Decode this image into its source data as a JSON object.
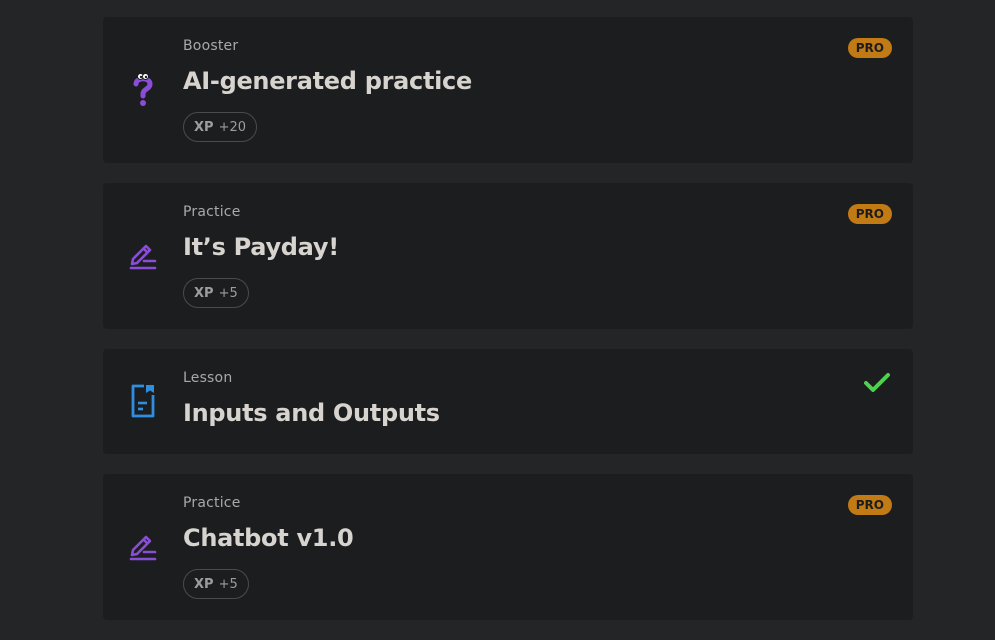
{
  "items": [
    {
      "kind": "Booster",
      "title": "AI-generated practice",
      "xp_label": "XP",
      "xp_value": "+20",
      "badge": "PRO",
      "icon": "question-mark-icon",
      "icon_color": "#8a4dd8"
    },
    {
      "kind": "Practice",
      "title": "It’s Payday!",
      "xp_label": "XP",
      "xp_value": "+5",
      "badge": "PRO",
      "icon": "pencil-edit-icon",
      "icon_color": "#8a4dd8"
    },
    {
      "kind": "Lesson",
      "title": "Inputs and Outputs",
      "status": "completed",
      "icon": "document-icon",
      "icon_color": "#2f8ee0",
      "check_color": "#4fd14f"
    },
    {
      "kind": "Practice",
      "title": "Chatbot v1.0",
      "xp_label": "XP",
      "xp_value": "+5",
      "badge": "PRO",
      "icon": "pencil-edit-icon",
      "icon_color": "#8a4dd8"
    }
  ],
  "colors": {
    "background": "#242527",
    "card": "#1c1d1f",
    "pro_badge": "#c27a14"
  }
}
